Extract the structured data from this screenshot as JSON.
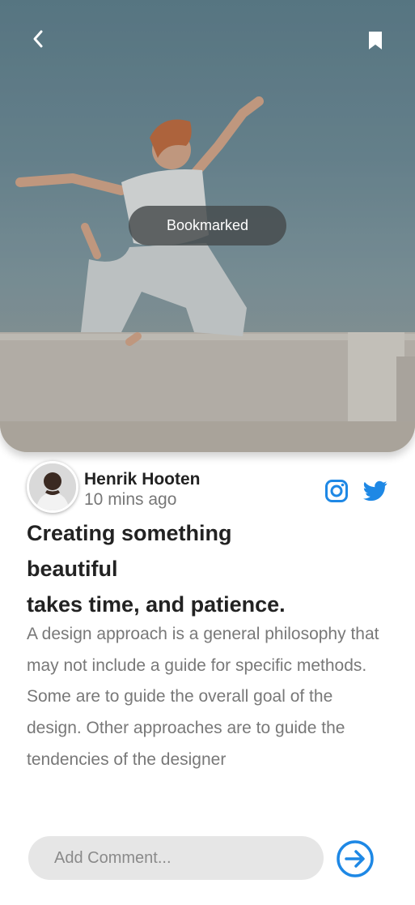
{
  "toast": {
    "text": "Bookmarked"
  },
  "icons": {
    "back": "chevron-left-icon",
    "bookmark": "bookmark-icon",
    "instagram": "instagram-icon",
    "twitter": "twitter-icon",
    "send": "arrow-right-circle-icon"
  },
  "colors": {
    "accent": "#1e88e5",
    "title": "#222222",
    "body": "#787878"
  },
  "author": {
    "name": "Henrik Hooten",
    "time": "10 mins ago"
  },
  "post": {
    "title_lines": [
      "Creating something",
      "beautiful",
      "takes time, and patience."
    ],
    "body": "A design approach is a general philosophy that may not include a guide for specific methods. Some are to guide the overall goal of the design. Other approaches are to guide the tendencies of the designer"
  },
  "comment": {
    "placeholder": "Add Comment..."
  }
}
